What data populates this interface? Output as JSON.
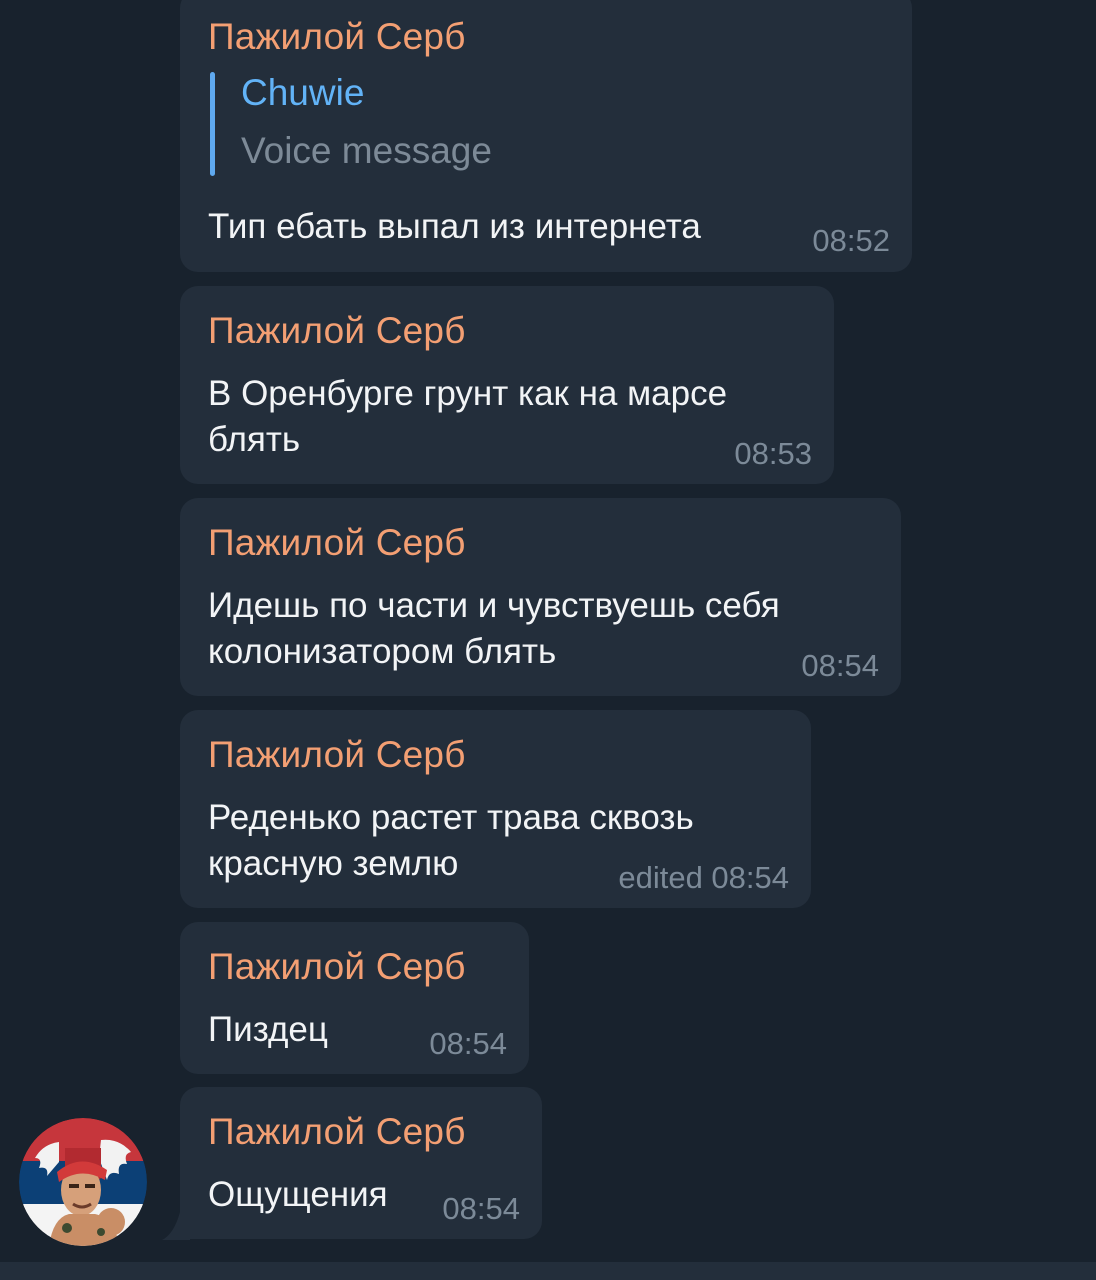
{
  "messages": [
    {
      "sender": "Пажилой Серб",
      "reply": {
        "name": "Chuwie",
        "text": "Voice message"
      },
      "lines": [
        "Тип ебать выпал из интернета"
      ],
      "time": "08:52"
    },
    {
      "sender": "Пажилой Серб",
      "lines": [
        "В Оренбурге грунт как на марсе",
        "блять"
      ],
      "time": "08:53"
    },
    {
      "sender": "Пажилой Серб",
      "lines": [
        "Идешь по части и чувствуешь себя",
        "колонизатором блять"
      ],
      "time": "08:54"
    },
    {
      "sender": "Пажилой Серб",
      "lines": [
        "Реденько растет трава сквозь",
        "красную землю"
      ],
      "time": "edited 08:54"
    },
    {
      "sender": "Пажилой Серб",
      "lines": [
        "Пиздец"
      ],
      "time": "08:54"
    },
    {
      "sender": "Пажилой Серб",
      "lines": [
        "Ощущения"
      ],
      "time": "08:54"
    }
  ],
  "colors": {
    "background": "#18222d",
    "bubble": "#232e3b",
    "sender_name": "#f39f73",
    "reply_accent": "#62b3f7",
    "text": "#f2f4f6",
    "meta": "#7c8a98"
  },
  "avatar": {
    "icon": "avatar-serbian-flag-icon"
  }
}
